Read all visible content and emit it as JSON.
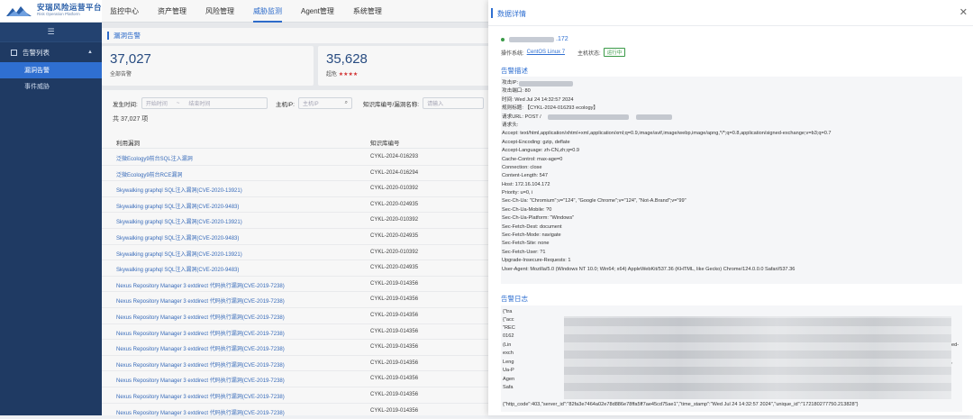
{
  "app": {
    "title": "安瑞风险运营平台",
    "subtitle": "Risk Operation Platform"
  },
  "nav": [
    "监控中心",
    "资产管理",
    "风险管理",
    "威胁监测",
    "Agent管理",
    "系统管理"
  ],
  "sidebar": {
    "collapse_icon": "menu-icon",
    "group": "告警列表",
    "items": [
      "漏洞告警",
      "事件威胁"
    ]
  },
  "page": {
    "title": "漏洞告警",
    "stats": [
      {
        "value": "37,027",
        "label": "全部告警",
        "stars": ""
      },
      {
        "value": "35,628",
        "label": "超危",
        "stars": "★★★★"
      }
    ],
    "filters": {
      "time_label": "发生时间:",
      "time_start": "开始时间",
      "time_sep": "~",
      "time_end": "结束时间",
      "host_label": "主机IP:",
      "host_placeholder": "主机IP",
      "rule_label": "知识库编号/漏洞名称:",
      "rule_placeholder": "请输入"
    },
    "count": "共 37,027 项",
    "columns": [
      "利用漏洞",
      "知识库编号"
    ],
    "rows": [
      [
        "泛微Ecology9前台SQL注入漏洞",
        "CYKL-2024-016293"
      ],
      [
        "泛微Ecology9前台RCE漏洞",
        "CYKL-2024-016294"
      ],
      [
        "Skywalking graphql SQL注入漏洞(CVE-2020-13921)",
        "CYKL-2020-010392"
      ],
      [
        "Skywalking graphql SQL注入漏洞(CVE-2020-9483)",
        "CYKL-2020-024935"
      ],
      [
        "Skywalking graphql SQL注入漏洞(CVE-2020-13921)",
        "CYKL-2020-010392"
      ],
      [
        "Skywalking graphql SQL注入漏洞(CVE-2020-9483)",
        "CYKL-2020-024935"
      ],
      [
        "Skywalking graphql SQL注入漏洞(CVE-2020-13921)",
        "CYKL-2020-010392"
      ],
      [
        "Skywalking graphql SQL注入漏洞(CVE-2020-9483)",
        "CYKL-2020-024935"
      ],
      [
        "Nexus Repository Manager 3 extdirect 代码执行漏洞(CVE-2019-7238)",
        "CYKL-2019-014356"
      ],
      [
        "Nexus Repository Manager 3 extdirect 代码执行漏洞(CVE-2019-7238)",
        "CYKL-2019-014356"
      ],
      [
        "Nexus Repository Manager 3 extdirect 代码执行漏洞(CVE-2019-7238)",
        "CYKL-2019-014356"
      ],
      [
        "Nexus Repository Manager 3 extdirect 代码执行漏洞(CVE-2019-7238)",
        "CYKL-2019-014356"
      ],
      [
        "Nexus Repository Manager 3 extdirect 代码执行漏洞(CVE-2019-7238)",
        "CYKL-2019-014356"
      ],
      [
        "Nexus Repository Manager 3 extdirect 代码执行漏洞(CVE-2019-7238)",
        "CYKL-2019-014356"
      ],
      [
        "Nexus Repository Manager 3 extdirect 代码执行漏洞(CVE-2019-7238)",
        "CYKL-2019-014356"
      ],
      [
        "Nexus Repository Manager 3 extdirect 代码执行漏洞(CVE-2019-7238)",
        "CYKL-2019-014356"
      ],
      [
        "Nexus Repository Manager 3 extdirect 代码执行漏洞(CVE-2019-7238)",
        "CYKL-2019-014356"
      ]
    ]
  },
  "panel": {
    "title": "数据详情",
    "close_icon": "close-icon",
    "host_suffix": ".172",
    "os_label": "操作系统:",
    "os_value": "CentOS Linux 7",
    "status_label": "主机状态:",
    "status_value": "运行中",
    "status_color": "#3a9a47",
    "desc_title": "告警描述",
    "desc_lines": [
      "攻击IP:",
      "攻击端口: 80",
      "时间: Wed Jul 24 14:32:57 2024",
      "规则标题: 【CYKL-2024-016293 ecology】",
      "请求URL: POST /",
      "请求头:",
      "Accept: text/html,application/xhtml+xml,application/xml;q=0.9,image/avif,image/webp,image/apng,*/*;q=0.8,application/signed-exchange;v=b3;q=0.7",
      "Accept-Encoding: gzip, deflate",
      "Accept-Language: zh-CN,zh;q=0.9",
      "Cache-Control: max-age=0",
      "Connection: close",
      "Content-Length: 547",
      "Host: 172.16.104.172",
      "Priority: u=0, i",
      "Sec-Ch-Ua: \"Chromium\";v=\"124\", \"Google Chrome\";v=\"124\", \"Not-A.Brand\";v=\"99\"",
      "Sec-Ch-Ua-Mobile: ?0",
      "Sec-Ch-Ua-Platform: \"Windows\"",
      "Sec-Fetch-Dest: document",
      "Sec-Fetch-Mode: navigate",
      "Sec-Fetch-Site: none",
      "Sec-Fetch-User: ?1",
      "Upgrade-Insecure-Requests: 1",
      "User-Agent: Mozilla/5.0 (Windows NT 10.0; Win64; x64) AppleWebKit/537.36 (KHTML, like Gecko) Chrome/124.0.0.0 Safari/537.36"
    ],
    "log_title": "告警日志",
    "log_fragments": [
      "{\"tra",
      "{\"acc",
      "\"REC",
      "0162",
      "(Lin",
      "exch",
      "Leng",
      "Ua-P",
      "Agen",
      "Safa",
      "ed-",
      ","
    ],
    "log_last": "{\"http_code\":403,\"server_id\":\"82fa3e7464a02e78d886e78ffa5ff7ae45cd75ae1\",\"time_stamp\":\"Wed Jul 24 14:32:57 2024\",\"unique_id\":\"172180277750.213828\"}"
  }
}
